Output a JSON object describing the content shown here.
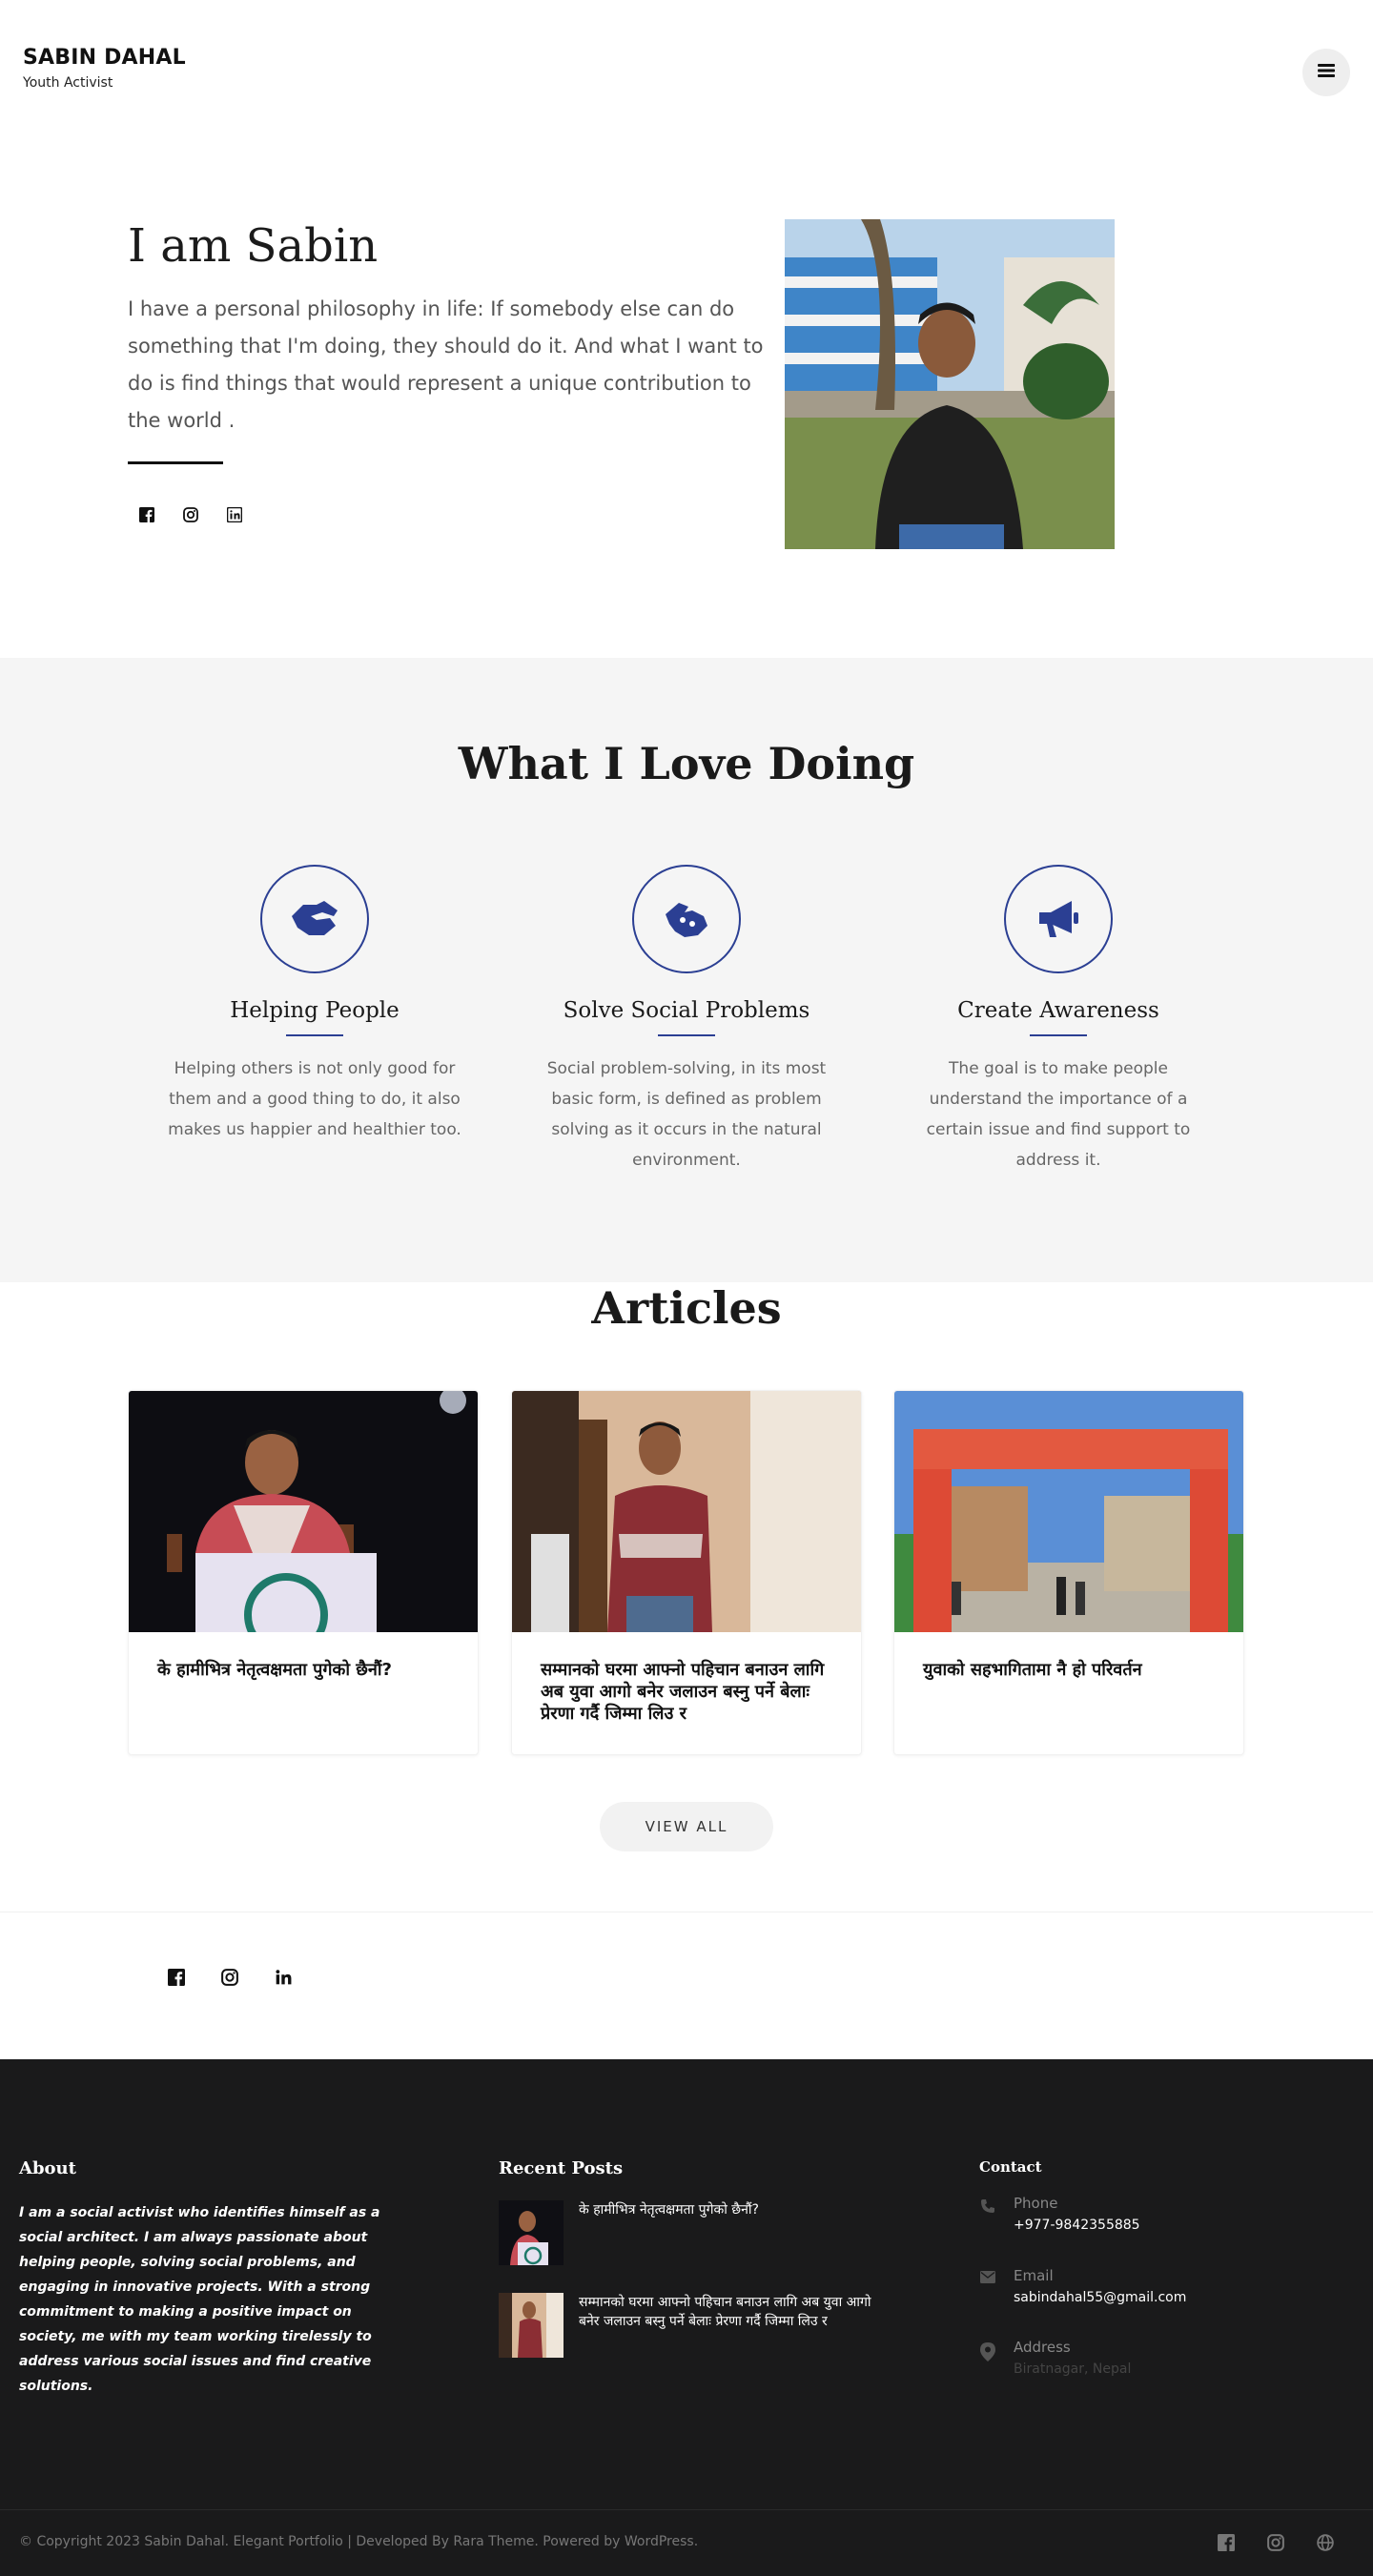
{
  "header": {
    "site_title": "SABIN DAHAL",
    "tagline": "Youth Activist",
    "menu_icon": "hamburger-menu-icon"
  },
  "hero": {
    "title": "I am Sabin",
    "text": "I have a personal philosophy in life: If somebody else can do something that I'm doing, they should do it. And what I want to do is find things that would represent a unique contribution to the world .",
    "social_icons": [
      "facebook-icon",
      "instagram-icon",
      "linkedin-icon"
    ]
  },
  "services": {
    "title": "What I Love Doing",
    "items": [
      {
        "name": "Helping People",
        "icon": "handshake-icon",
        "desc": "Helping others is not only good for them and a good thing to do, it also makes us happier and healthier too."
      },
      {
        "name": "Solve Social Problems",
        "icon": "sign-language-icon",
        "desc": "Social problem-solving, in its most basic form, is defined as problem solving as it occurs in the natural environment."
      },
      {
        "name": "Create Awareness",
        "icon": "megaphone-icon",
        "desc": "The goal is to make people understand the importance of a certain issue and find support to address it."
      }
    ],
    "accent_color": "#2b3f93"
  },
  "articles": {
    "title": "Articles",
    "items": [
      {
        "title": "के हामीभित्र नेतृत्वक्षमता पुगेको छैनौं?"
      },
      {
        "title": "सम्मानको घरमा आफ्नो पहिचान बनाउन लागि अब युवा आगो बनेर जलाउन बस्नु पर्ने बेलाः प्रेरणा गर्दै जिम्मा लिउ र"
      },
      {
        "title": "युवाको सहभागितामा नै हो परिवर्तन"
      }
    ],
    "view_all": "VIEW ALL"
  },
  "footer": {
    "about_title": "About",
    "about_text": "I am a social activist who identifies himself as a social architect. I am always passionate about helping people, solving social problems, and engaging in innovative projects. With a strong commitment to making a positive impact on society, me with my team working tirelessly to address various social issues and find creative solutions.",
    "recent_title": "Recent Posts",
    "recent_posts": [
      {
        "title": "के हामीभित्र नेतृत्वक्षमता पुगेको छैनौं?"
      },
      {
        "title": "सम्मानको घरमा आफ्नो पहिचान बनाउन लागि अब युवा आगो बनेर जलाउन बस्नु पर्ने बेलाः प्रेरणा गर्दै जिम्मा लिउ र"
      }
    ],
    "contact_title": "Contact",
    "phone_label": "Phone",
    "phone": "+977-9842355885",
    "email_label": "Email",
    "email": "sabindahal55@gmail.com",
    "address_label": "Address",
    "address": "Biratnagar, Nepal",
    "copyright": "© Copyright 2023 Sabin Dahal. Elegant Portfolio | Developed By Rara Theme. Powered by WordPress.",
    "bottom_icons": [
      "facebook-icon",
      "instagram-icon",
      "globe-icon"
    ]
  }
}
